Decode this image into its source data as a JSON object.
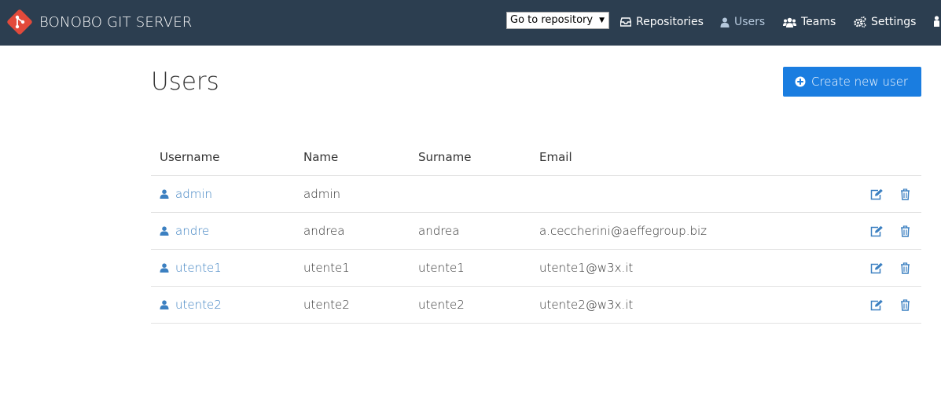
{
  "app": {
    "brand": "BONOBO GIT SERVER",
    "colors": {
      "navbar": "#2c3e50",
      "accent": "#1a7de0",
      "link": "#3c80c1",
      "brand_red": "#e24a3b"
    }
  },
  "nav": {
    "repo_select": "Go to repository",
    "items": [
      {
        "label": "Repositories",
        "icon": "inbox-icon"
      },
      {
        "label": "Users",
        "icon": "user-icon"
      },
      {
        "label": "Teams",
        "icon": "users-icon"
      },
      {
        "label": "Settings",
        "icon": "gears-icon"
      }
    ],
    "active": "Users"
  },
  "page": {
    "title": "Users",
    "create_button": "Create new user"
  },
  "table": {
    "headers": [
      "Username",
      "Name",
      "Surname",
      "Email"
    ],
    "rows": [
      {
        "username": "admin",
        "name": "admin",
        "surname": "",
        "email": ""
      },
      {
        "username": "andre",
        "name": "andrea",
        "surname": "andrea",
        "email": "a.ceccherini@aeffegroup.biz"
      },
      {
        "username": "utente1",
        "name": "utente1",
        "surname": "utente1",
        "email": "utente1@w3x.it"
      },
      {
        "username": "utente2",
        "name": "utente2",
        "surname": "utente2",
        "email": "utente2@w3x.it"
      }
    ]
  }
}
